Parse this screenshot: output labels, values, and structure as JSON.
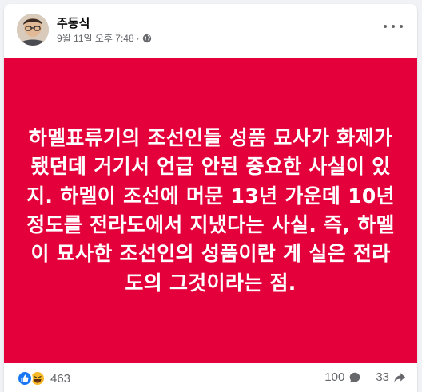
{
  "post": {
    "author": "주동식",
    "timestamp": "9월 11일 오후 7:48",
    "separator": "·",
    "audience_icon": "globe-icon",
    "more_icon": "more-horizontal-icon",
    "background_color": "#e4003a",
    "body_text": "하멜표류기의 조선인들 성품 묘사가 화제가 됐던데 거기서 언급 안된 중요한 사실이 있지. 하멜이 조선에 머문 13년 가운데 10년 정도를 전라도에서 지냈다는 사실. 즉, 하멜이 묘사한 조선인의 성품이란 게 실은 전라도의 그것이라는 점."
  },
  "footer": {
    "reaction_icons": [
      "like-icon",
      "haha-icon"
    ],
    "reaction_count": "463",
    "comment_count": "100",
    "comment_icon": "comment-icon",
    "share_count": "33",
    "share_icon": "share-icon"
  }
}
